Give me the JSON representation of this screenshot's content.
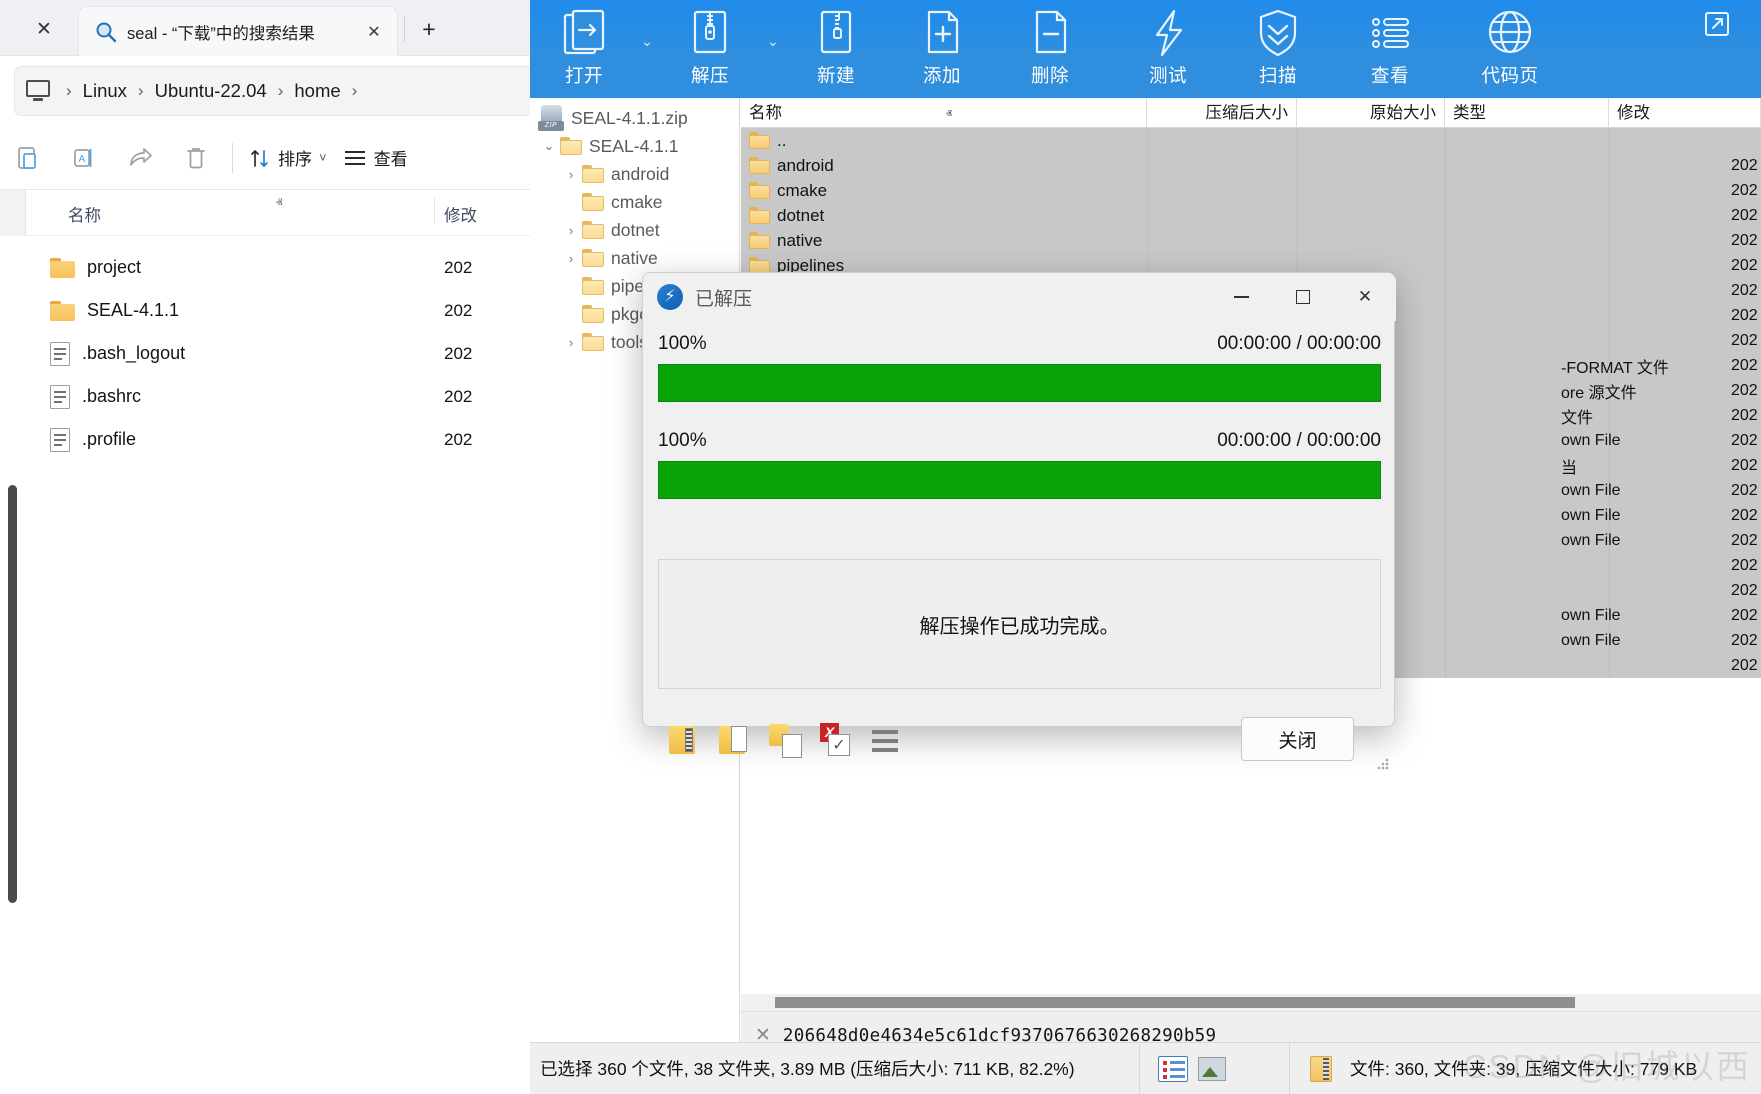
{
  "explorer": {
    "tab": {
      "label": "seal - “下载”中的搜索结果",
      "icon": "search-icon",
      "close": "✕"
    },
    "window_close": "✕",
    "new_tab": "+",
    "breadcrumbs": [
      "Linux",
      "Ubuntu-22.04",
      "home"
    ],
    "breadcrumb_separator": "›",
    "toolbar": {
      "paste_label": "paste-icon",
      "rename_label": "rename-icon",
      "share_label": "share-icon",
      "delete_label": "delete-icon",
      "sort_label": "排序",
      "view_label": "查看",
      "chevron": "˅"
    },
    "columns": {
      "name": "名称",
      "modified": "修改"
    },
    "sort_caret": "ⱏ",
    "rows": [
      {
        "name": "project",
        "type": "folder",
        "modified": "202"
      },
      {
        "name": "SEAL-4.1.1",
        "type": "folder",
        "modified": "202"
      },
      {
        "name": ".bash_logout",
        "type": "file",
        "modified": "202"
      },
      {
        "name": ".bashrc",
        "type": "file",
        "modified": "202"
      },
      {
        "name": ".profile",
        "type": "file",
        "modified": "202"
      }
    ]
  },
  "sevenzip": {
    "ribbon": [
      {
        "label": "打开",
        "icon": "open-archive-icon",
        "caret": true
      },
      {
        "label": "解压",
        "icon": "extract-icon",
        "caret": true
      },
      {
        "label": "新建",
        "icon": "new-archive-icon",
        "caret": false
      },
      {
        "label": "添加",
        "icon": "add-file-icon",
        "caret": false
      },
      {
        "label": "删除",
        "icon": "delete-file-icon",
        "caret": false
      },
      {
        "label": "测试",
        "icon": "test-lightning-icon",
        "caret": false
      },
      {
        "label": "扫描",
        "icon": "scan-shield-icon",
        "caret": false
      },
      {
        "label": "查看",
        "icon": "view-list-icon",
        "caret": false
      },
      {
        "label": "代码页",
        "icon": "codepage-globe-icon",
        "caret": false
      }
    ],
    "tree": {
      "root": {
        "label": "SEAL-4.1.1.zip",
        "icon": "zip-archive-icon"
      },
      "nodes": [
        {
          "label": "SEAL-4.1.1",
          "chevron": "⌄",
          "indent": 0,
          "expanded": true
        },
        {
          "label": "android",
          "chevron": "›",
          "indent": 1
        },
        {
          "label": "cmake",
          "chevron": "",
          "indent": 1
        },
        {
          "label": "dotnet",
          "chevron": "›",
          "indent": 1
        },
        {
          "label": "native",
          "chevron": "›",
          "indent": 1
        },
        {
          "label": "pipelines",
          "chevron": "",
          "indent": 1
        },
        {
          "label": "pkgconfig",
          "chevron": "",
          "indent": 1
        },
        {
          "label": "tools",
          "chevron": "›",
          "indent": 1
        }
      ]
    },
    "columns": [
      {
        "key": "name",
        "label": "名称",
        "align": "left"
      },
      {
        "key": "packed",
        "label": "压缩后大小",
        "align": "right"
      },
      {
        "key": "original",
        "label": "原始大小",
        "align": "right"
      },
      {
        "key": "type",
        "label": "类型",
        "align": "left"
      },
      {
        "key": "modified",
        "label": "修改",
        "align": "left"
      }
    ],
    "sort_mark": "ⱏ",
    "rows": [
      {
        "name": "..",
        "kind": "folder",
        "type": "",
        "modified": ""
      },
      {
        "name": "android",
        "kind": "folder",
        "type": "",
        "modified": "202"
      },
      {
        "name": "cmake",
        "kind": "folder",
        "type": "",
        "modified": "202"
      },
      {
        "name": "dotnet",
        "kind": "folder",
        "type": "",
        "modified": "202"
      },
      {
        "name": "native",
        "kind": "folder",
        "type": "",
        "modified": "202"
      },
      {
        "name": "pipelines",
        "kind": "folder",
        "type": "",
        "modified": "202"
      },
      {
        "name": "",
        "kind": "folder",
        "type": "",
        "modified": "202"
      },
      {
        "name": "",
        "kind": "none",
        "type": "",
        "modified": "202"
      },
      {
        "name": "",
        "kind": "none",
        "type": "",
        "modified": "202"
      },
      {
        "name": "",
        "kind": "none",
        "type": "-FORMAT 文件",
        "modified": "202"
      },
      {
        "name": "",
        "kind": "none",
        "type": "ore 源文件",
        "modified": "202"
      },
      {
        "name": "",
        "kind": "none",
        "type": "文件",
        "modified": "202"
      },
      {
        "name": "",
        "kind": "none",
        "type": "own File",
        "modified": "202"
      },
      {
        "name": "",
        "kind": "none",
        "type": "当",
        "modified": "202"
      },
      {
        "name": "",
        "kind": "none",
        "type": "own File",
        "modified": "202"
      },
      {
        "name": "",
        "kind": "none",
        "type": "own File",
        "modified": "202"
      },
      {
        "name": "",
        "kind": "none",
        "type": "own File",
        "modified": "202"
      },
      {
        "name": "",
        "kind": "none",
        "type": "",
        "modified": "202"
      },
      {
        "name": "",
        "kind": "none",
        "type": "",
        "modified": "202"
      },
      {
        "name": "",
        "kind": "none",
        "type": "own File",
        "modified": "202"
      },
      {
        "name": "",
        "kind": "none",
        "type": "own File",
        "modified": "202"
      },
      {
        "name": "",
        "kind": "none",
        "type": "",
        "modified": "202"
      }
    ],
    "hash_bar": {
      "close": "✕",
      "value": "206648d0e4634e5c61dcf9370676630268290b59"
    },
    "status": {
      "selection": "已选择 360 个文件, 38 文件夹, 3.89 MB (压缩后大小: 711 KB, 82.2%)",
      "totals": "文件: 360, 文件夹: 39, 压缩文件大小: 779 KB",
      "view_icons": [
        "detail-view-icon",
        "preview-view-icon",
        "archive-icon"
      ]
    },
    "watermark": "CSDN @旧城以西"
  },
  "dialog": {
    "title": "已解压",
    "icon": "lightning-bolt-icon",
    "controls": {
      "minimize": "–",
      "maximize": "□",
      "close": "✕"
    },
    "progress": [
      {
        "percent": "100%",
        "time": "00:00:00 / 00:00:00",
        "value": 100
      },
      {
        "percent": "100%",
        "time": "00:00:00 / 00:00:00",
        "value": 100
      }
    ],
    "message": "解压操作已成功完成。",
    "footer_icons": [
      "open-folder-archive-icon",
      "open-folder-icon",
      "copy-to-folder-icon",
      "delete-confirm-icon",
      "menu-icon"
    ],
    "close_button": "关闭",
    "progress_color": "#08a308"
  }
}
